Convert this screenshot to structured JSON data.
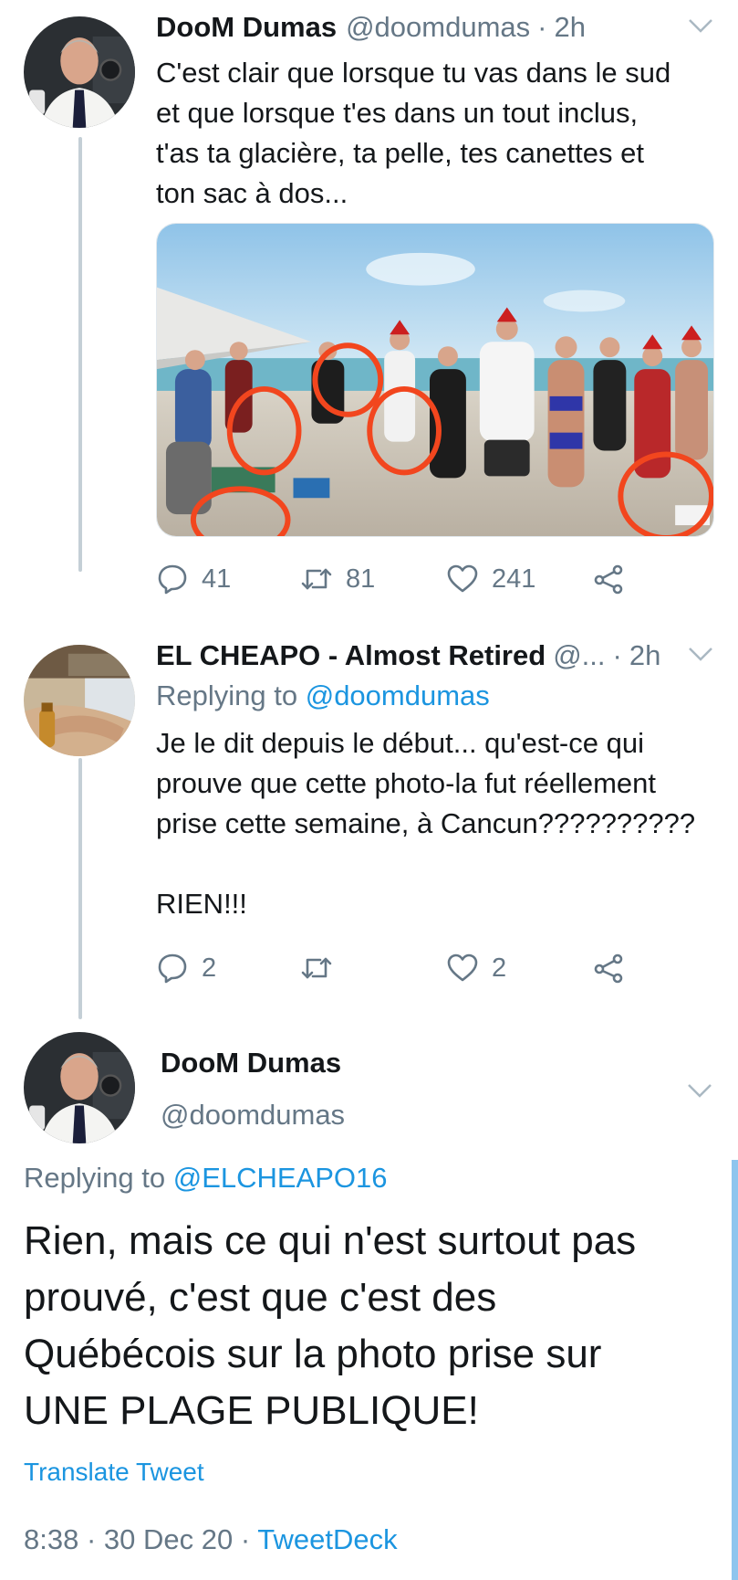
{
  "tweets": [
    {
      "name": "DooM Dumas",
      "handle": "@doomdumas",
      "separator": "·",
      "time": "2h",
      "text_lines": [
        "C'est clair que lorsque tu vas dans le sud",
        "et que lorsque t'es dans un tout inclus,",
        "t'as ta glacière, ta pelle, tes canettes et",
        "ton sac à dos..."
      ],
      "replies": "41",
      "retweets": "81",
      "likes": "241"
    },
    {
      "name": "EL CHEAPO - Almost Retired",
      "handle": "@...",
      "separator": "·",
      "time": "2h",
      "replying_prefix": "Replying to",
      "replying_handle": "@doomdumas",
      "text_lines": [
        "Je le dit depuis le début... qu'est-ce qui",
        "prouve que cette photo-la fut réellement",
        "prise cette semaine, à Cancun??????????"
      ],
      "text_extra": "RIEN!!!",
      "replies": "2",
      "retweets": "",
      "likes": "2"
    }
  ],
  "main": {
    "name": "DooM Dumas",
    "handle": "@doomdumas",
    "replying_prefix": "Replying to",
    "replying_handle": "@ELCHEAPO16",
    "text_lines": [
      "Rien, mais ce qui n'est surtout pas",
      "prouvé, c'est que c'est des",
      "Québécois sur la photo prise sur",
      "UNE PLAGE PUBLIQUE!"
    ],
    "translate_label": "Translate Tweet",
    "time": "8:38",
    "separator": "·",
    "date": "30 Dec 20",
    "source": "TweetDeck"
  },
  "colors": {
    "link": "#1b95e0",
    "secondary": "#657786",
    "thread": "#c4cfd6",
    "circle_annotation": "#f2461e"
  },
  "icons": [
    "chevron-down-icon",
    "reply-icon",
    "retweet-icon",
    "like-icon",
    "share-icon"
  ]
}
